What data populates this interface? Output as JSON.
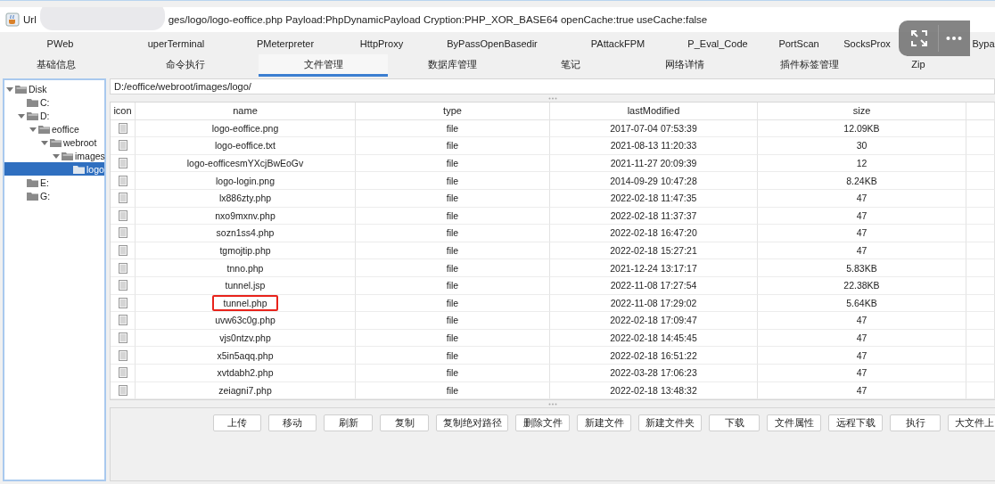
{
  "window": {
    "title_start": "Url",
    "title_end": "ges/logo/logo-eoffice.php Payload:PhpDynamicPayload Cryption:PHP_XOR_BASE64 openCache:true useCache:false"
  },
  "plugin_tabs": [
    "PWeb",
    "uperTerminal",
    "PMeterpreter",
    "HttpProxy",
    "ByPassOpenBasedir",
    "PAttackFPM",
    "P_Eval_Code",
    "PortScan",
    "SocksProx",
    "Bypa"
  ],
  "tabs": [
    {
      "label": "基础信息",
      "selected": false
    },
    {
      "label": "命令执行",
      "selected": false
    },
    {
      "label": "文件管理",
      "selected": true
    },
    {
      "label": "数据库管理",
      "selected": false
    },
    {
      "label": "笔记",
      "selected": false
    },
    {
      "label": "网络详情",
      "selected": false
    },
    {
      "label": "插件标签管理",
      "selected": false
    },
    {
      "label": "Zip",
      "selected": false
    }
  ],
  "tree": [
    {
      "label": "Disk",
      "expanded": true,
      "selected": false,
      "children": [
        {
          "label": "C:",
          "expanded": false,
          "selected": false
        },
        {
          "label": "D:",
          "expanded": true,
          "selected": false,
          "children": [
            {
              "label": "eoffice",
              "expanded": true,
              "selected": false,
              "children": [
                {
                  "label": "webroot",
                  "expanded": true,
                  "selected": false,
                  "children": [
                    {
                      "label": "images",
                      "expanded": true,
                      "selected": false,
                      "children": [
                        {
                          "label": "logo",
                          "expanded": false,
                          "selected": true
                        }
                      ]
                    }
                  ]
                }
              ]
            }
          ]
        },
        {
          "label": "E:",
          "expanded": false,
          "selected": false
        },
        {
          "label": "G:",
          "expanded": false,
          "selected": false
        }
      ]
    }
  ],
  "path": "D:/eoffice/webroot/images/logo/",
  "table": {
    "columns": [
      "icon",
      "name",
      "type",
      "lastModified",
      "size"
    ],
    "rows": [
      {
        "name": "logo-eoffice.png",
        "type": "file",
        "lastModified": "2017-07-04 07:53:39",
        "size": "12.09KB",
        "highlighted": false
      },
      {
        "name": "logo-eoffice.txt",
        "type": "file",
        "lastModified": "2021-08-13 11:20:33",
        "size": "30",
        "highlighted": false
      },
      {
        "name": "logo-eofficesmYXcjBwEoGv",
        "type": "file",
        "lastModified": "2021-11-27 20:09:39",
        "size": "12",
        "highlighted": false
      },
      {
        "name": "logo-login.png",
        "type": "file",
        "lastModified": "2014-09-29 10:47:28",
        "size": "8.24KB",
        "highlighted": false
      },
      {
        "name": "lx886zty.php",
        "type": "file",
        "lastModified": "2022-02-18 11:47:35",
        "size": "47",
        "highlighted": false
      },
      {
        "name": "nxo9mxnv.php",
        "type": "file",
        "lastModified": "2022-02-18 11:37:37",
        "size": "47",
        "highlighted": false
      },
      {
        "name": "sozn1ss4.php",
        "type": "file",
        "lastModified": "2022-02-18 16:47:20",
        "size": "47",
        "highlighted": false
      },
      {
        "name": "tgmojtip.php",
        "type": "file",
        "lastModified": "2022-02-18 15:27:21",
        "size": "47",
        "highlighted": false
      },
      {
        "name": "tnno.php",
        "type": "file",
        "lastModified": "2021-12-24 13:17:17",
        "size": "5.83KB",
        "highlighted": false
      },
      {
        "name": "tunnel.jsp",
        "type": "file",
        "lastModified": "2022-11-08 17:27:54",
        "size": "22.38KB",
        "highlighted": false
      },
      {
        "name": "tunnel.php",
        "type": "file",
        "lastModified": "2022-11-08 17:29:02",
        "size": "5.64KB",
        "highlighted": true
      },
      {
        "name": "uvw63c0g.php",
        "type": "file",
        "lastModified": "2022-02-18 17:09:47",
        "size": "47",
        "highlighted": false
      },
      {
        "name": "vjs0ntzv.php",
        "type": "file",
        "lastModified": "2022-02-18 14:45:45",
        "size": "47",
        "highlighted": false
      },
      {
        "name": "x5in5aqq.php",
        "type": "file",
        "lastModified": "2022-02-18 16:51:22",
        "size": "47",
        "highlighted": false
      },
      {
        "name": "xvtdabh2.php",
        "type": "file",
        "lastModified": "2022-03-28 17:06:23",
        "size": "47",
        "highlighted": false
      },
      {
        "name": "zeiagni7.php",
        "type": "file",
        "lastModified": "2022-02-18 13:48:32",
        "size": "47",
        "highlighted": false
      }
    ]
  },
  "buttons": [
    "上传",
    "移动",
    "刷新",
    "复制",
    "复制绝对路径",
    "删除文件",
    "新建文件",
    "新建文件夹",
    "下载",
    "文件属性",
    "远程下载",
    "执行",
    "大文件上"
  ]
}
